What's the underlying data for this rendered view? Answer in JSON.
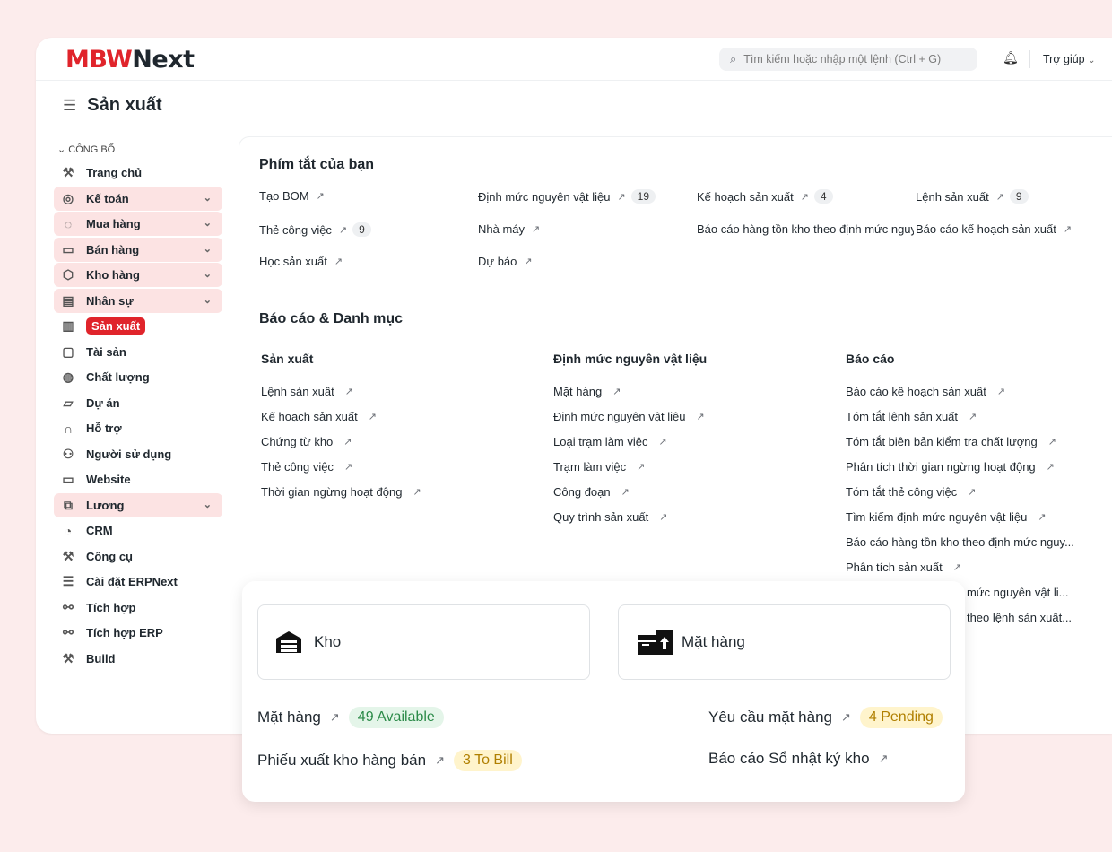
{
  "header": {
    "logo_mark": "MBW",
    "logo_text": "Next",
    "search_placeholder": "Tìm kiếm hoặc nhập một lệnh (Ctrl + G)",
    "help_label": "Trợ giúp"
  },
  "page": {
    "title": "Sản xuất"
  },
  "sidebar": {
    "section_label": "CÔNG BỐ",
    "items": [
      {
        "label": "Trang chủ",
        "icon": "tools-icon",
        "glyph": "⚒",
        "expandable": false
      },
      {
        "label": "Kế toán",
        "icon": "accounting-icon",
        "glyph": "◎",
        "expandable": true
      },
      {
        "label": "Mua hàng",
        "icon": "purchase-icon",
        "glyph": "◌",
        "expandable": true
      },
      {
        "label": "Bán hàng",
        "icon": "sales-icon",
        "glyph": "▭",
        "expandable": true
      },
      {
        "label": "Kho hàng",
        "icon": "box-icon",
        "glyph": "⬡",
        "expandable": true
      },
      {
        "label": "Nhân sự",
        "icon": "hr-icon",
        "glyph": "▤",
        "expandable": true
      },
      {
        "label": "Sản xuất",
        "icon": "factory-icon",
        "glyph": "▥",
        "expandable": false,
        "active": true
      },
      {
        "label": "Tài sản",
        "icon": "asset-icon",
        "glyph": "▢",
        "expandable": false
      },
      {
        "label": "Chất lượng",
        "icon": "quality-icon",
        "glyph": "◍",
        "expandable": false
      },
      {
        "label": "Dự án",
        "icon": "folder-icon",
        "glyph": "▱",
        "expandable": false
      },
      {
        "label": "Hỗ trợ",
        "icon": "headset-icon",
        "glyph": "∩",
        "expandable": false
      },
      {
        "label": "Người sử dụng",
        "icon": "users-icon",
        "glyph": "⚇",
        "expandable": false
      },
      {
        "label": "Website",
        "icon": "browser-icon",
        "glyph": "▭",
        "expandable": false
      },
      {
        "label": "Lương",
        "icon": "payroll-icon",
        "glyph": "⧉",
        "expandable": true
      },
      {
        "label": "CRM",
        "icon": "chart-icon",
        "glyph": "◔",
        "expandable": false
      },
      {
        "label": "Công cụ",
        "icon": "tools-icon",
        "glyph": "⚒",
        "expandable": false
      },
      {
        "label": "Cài đặt ERPNext",
        "icon": "settings-icon",
        "glyph": "☰",
        "expandable": false
      },
      {
        "label": "Tích hợp",
        "icon": "plug-icon",
        "glyph": "⚯",
        "expandable": false
      },
      {
        "label": "Tích hợp ERP",
        "icon": "plug-icon",
        "glyph": "⚯",
        "expandable": false
      },
      {
        "label": "Build",
        "icon": "tools-icon",
        "glyph": "⚒",
        "expandable": false
      }
    ]
  },
  "shortcuts": {
    "title": "Phím tắt của bạn",
    "items": [
      {
        "label": "Tạo BOM",
        "count": ""
      },
      {
        "label": "Định mức nguyên vật liệu",
        "count": "19"
      },
      {
        "label": "Kế hoạch sản xuất",
        "count": "4"
      },
      {
        "label": "Lệnh sản xuất",
        "count": "9"
      },
      {
        "label": "Thẻ công việc",
        "count": "9"
      },
      {
        "label": "Nhà máy",
        "count": ""
      },
      {
        "label": "Báo cáo hàng tồn kho theo định mức nguyên vật liệu",
        "count": ""
      },
      {
        "label": "Báo cáo kế hoạch sản xuất",
        "count": ""
      },
      {
        "label": "Học sản xuất",
        "count": ""
      },
      {
        "label": "Dự báo",
        "count": ""
      }
    ]
  },
  "reports": {
    "title": "Báo cáo & Danh mục",
    "columns": [
      {
        "title": "Sản xuất",
        "links": [
          "Lệnh sản xuất",
          "Kế hoạch sản xuất",
          "Chứng từ kho",
          "Thẻ công việc",
          "Thời gian ngừng hoạt động"
        ]
      },
      {
        "title": "Định mức nguyên vật liệu",
        "links": [
          "Mặt hàng",
          "Định mức nguyên vật liệu",
          "Loại trạm làm việc",
          "Trạm làm việc",
          "Công đoạn",
          "Quy trình sản xuất"
        ]
      },
      {
        "title": "Báo cáo",
        "links": [
          "Báo cáo kế hoạch sản xuất",
          "Tóm tắt lệnh sản xuất",
          "Tóm tắt biên bản kiểm tra chất lượng",
          "Phân tích thời gian ngừng hoạt động",
          "Tóm tắt thẻ công việc",
          "Tìm kiếm định mức nguyên vật liệu",
          "Báo cáo hàng tồn kho theo định mức nguy...",
          "Phân tích sản xuất",
          "ịnh mức nguyên vật li...",
          "iệu theo lệnh sản xuất..."
        ]
      }
    ]
  },
  "overlay": {
    "cards": [
      {
        "label": "Kho",
        "icon": "warehouse-icon"
      },
      {
        "label": "Mặt hàng",
        "icon": "items-icon"
      }
    ],
    "links": [
      {
        "label": "Mặt hàng",
        "badge": "49 Available",
        "tone": "green"
      },
      {
        "label": "Yêu cầu mặt hàng",
        "badge": "4 Pending",
        "tone": "yellow"
      },
      {
        "label": "Phiếu xuất kho hàng bán",
        "badge": "3 To Bill",
        "tone": "yellow"
      },
      {
        "label": "Báo cáo Sổ nhật ký kho",
        "badge": "",
        "tone": ""
      }
    ]
  }
}
